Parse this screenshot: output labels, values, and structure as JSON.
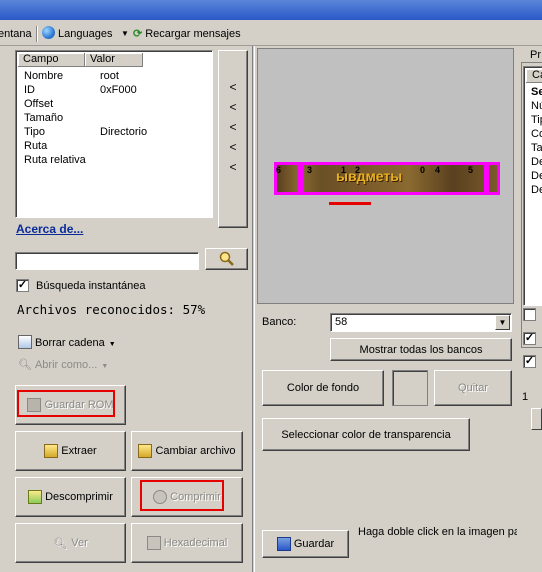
{
  "menu": {
    "window_label": "entana",
    "languages_label": "Languages",
    "reload_label": "Recargar mensajes"
  },
  "properties": {
    "columns": [
      "Campo",
      "Valor"
    ],
    "rows": [
      {
        "field": "Nombre",
        "value": "root"
      },
      {
        "field": "ID",
        "value": "0xF000"
      },
      {
        "field": "Offset",
        "value": ""
      },
      {
        "field": "Tamaño",
        "value": ""
      },
      {
        "field": "Tipo",
        "value": "Directorio"
      },
      {
        "field": "Ruta",
        "value": ""
      },
      {
        "field": "Ruta relativa",
        "value": ""
      }
    ]
  },
  "nav_arrows": [
    "<",
    "<",
    "<",
    "<",
    "<"
  ],
  "about_link": "Acerca de...",
  "search": {
    "value": "",
    "instant_label": "Búsqueda instantánea",
    "instant_checked": true
  },
  "recognized_text": "Archivos reconocidos: 57%",
  "actions": {
    "delete_string": "Borrar cadena",
    "open_as": "Abrir como...",
    "save_rom": "Guardar ROM",
    "extract": "Extraer",
    "change_file": "Cambiar archivo",
    "decompress": "Descomprimir",
    "compress": "Comprimir",
    "view": "Ver",
    "hex": "Hexadecimal"
  },
  "image_panel": {
    "sprite_text": "ывдметы",
    "sprite_numbers": [
      "6",
      "3",
      "1",
      "2",
      "0",
      "4",
      "5"
    ]
  },
  "bank": {
    "label": "Banco:",
    "value": "58",
    "show_all": "Mostrar todas los bancos"
  },
  "colors": {
    "background_button": "Color de fondo",
    "remove_button": "Quitar",
    "transparency_button": "Seleccionar color de transparencia"
  },
  "bottom": {
    "save_button": "Guardar",
    "hint": "Haga doble click en la imagen para ver"
  },
  "right_panel": {
    "header": "Pr",
    "column": "Ca",
    "rows": [
      "Se",
      "Nú",
      "Tip",
      "Co",
      "Ta",
      "De",
      "De",
      "De"
    ],
    "slider_value": "1"
  },
  "accent_color": "#e60000"
}
